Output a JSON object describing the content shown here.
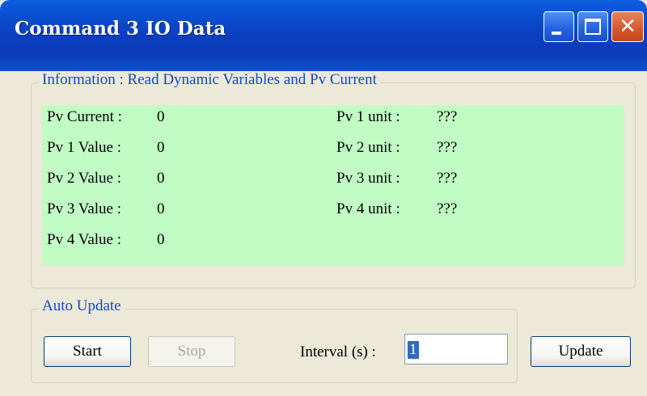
{
  "window": {
    "title": "Command 3 IO Data",
    "controls": {
      "minimize": "minimize-icon",
      "maximize": "maximize-icon",
      "close": "close-icon"
    }
  },
  "info": {
    "group_label": "Information : Read Dynamic Variables and Pv Current",
    "left_rows": [
      {
        "label": "Pv Current :",
        "value": "0"
      },
      {
        "label": "Pv 1 Value :",
        "value": "0"
      },
      {
        "label": "Pv 2 Value :",
        "value": "0"
      },
      {
        "label": "Pv 3 Value :",
        "value": "0"
      },
      {
        "label": "Pv 4 Value :",
        "value": "0"
      }
    ],
    "right_rows": [
      {
        "label": "Pv 1 unit :",
        "value": "???"
      },
      {
        "label": "Pv 2 unit :",
        "value": "???"
      },
      {
        "label": "Pv 3 unit :",
        "value": "???"
      },
      {
        "label": "Pv 4 unit :",
        "value": "???"
      }
    ]
  },
  "auto_update": {
    "group_label": "Auto Update",
    "start_label": "Start",
    "stop_label": "Stop",
    "interval_label": "Interval (s) :",
    "interval_value": "1"
  },
  "update_label": "Update",
  "colors": {
    "titlebar": "#0a3bb8",
    "panel_bg": "#c0fcc4",
    "group_label": "#1447c9",
    "window_bg": "#ece9d8"
  }
}
